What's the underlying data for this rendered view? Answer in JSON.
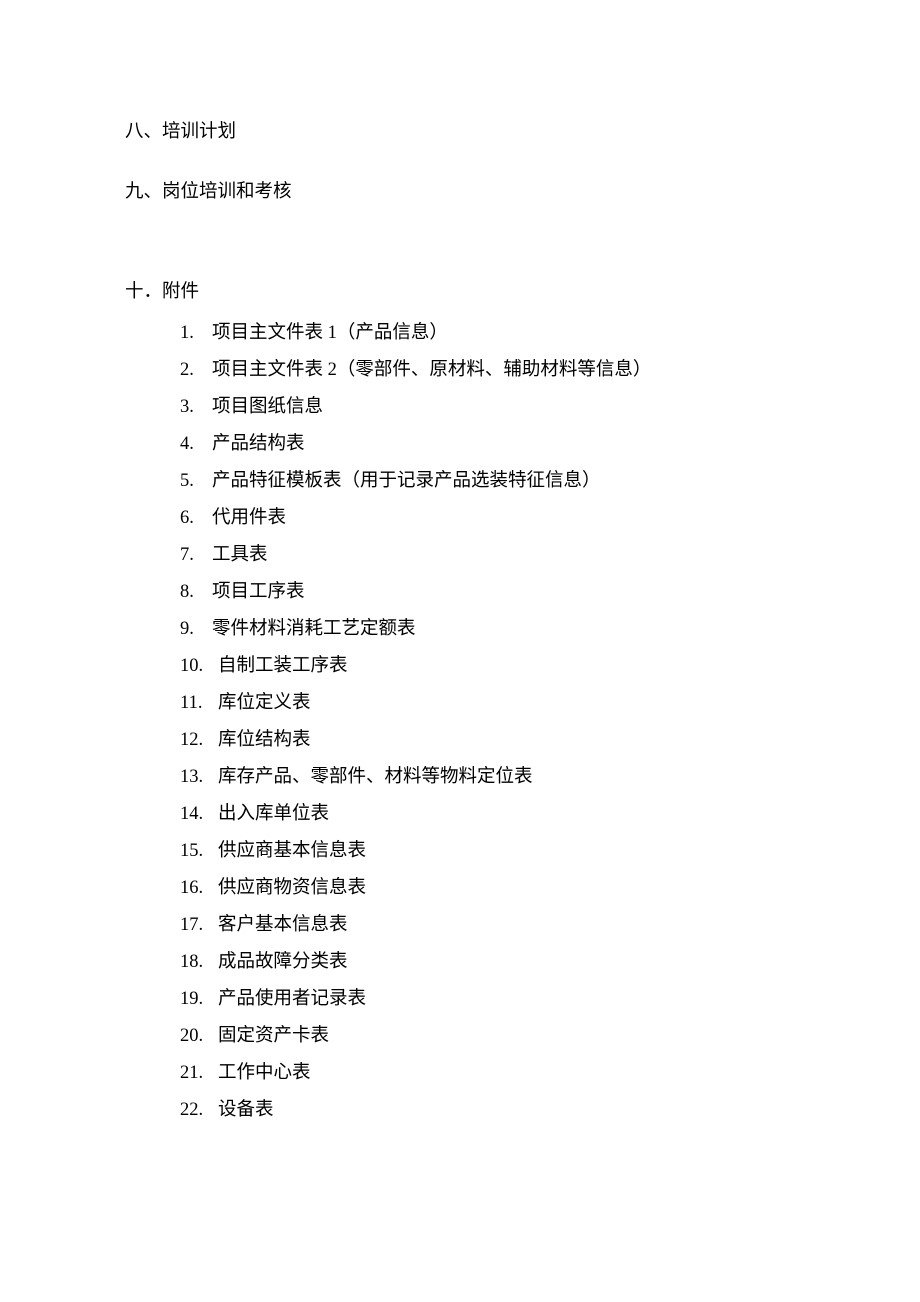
{
  "headings": {
    "h8": "八、培训计划",
    "h9": "九、岗位培训和考核",
    "h10": "十．附件"
  },
  "attachments": [
    {
      "num": "1.",
      "text": "项目主文件表 1（产品信息）"
    },
    {
      "num": "2.",
      "text": "项目主文件表 2（零部件、原材料、辅助材料等信息）"
    },
    {
      "num": "3.",
      "text": "项目图纸信息"
    },
    {
      "num": "4.",
      "text": "产品结构表"
    },
    {
      "num": "5.",
      "text": "产品特征模板表（用于记录产品选装特征信息）"
    },
    {
      "num": "6.",
      "text": "代用件表"
    },
    {
      "num": "7.",
      "text": "工具表"
    },
    {
      "num": "8.",
      "text": "项目工序表"
    },
    {
      "num": "9.",
      "text": "零件材料消耗工艺定额表"
    },
    {
      "num": "10.",
      "text": "自制工装工序表"
    },
    {
      "num": "11.",
      "text": "库位定义表"
    },
    {
      "num": "12.",
      "text": "库位结构表"
    },
    {
      "num": "13.",
      "text": "库存产品、零部件、材料等物料定位表"
    },
    {
      "num": "14.",
      "text": "出入库单位表"
    },
    {
      "num": "15.",
      "text": "供应商基本信息表"
    },
    {
      "num": "16.",
      "text": "供应商物资信息表"
    },
    {
      "num": "17.",
      "text": "客户基本信息表"
    },
    {
      "num": "18.",
      "text": "成品故障分类表"
    },
    {
      "num": "19.",
      "text": "产品使用者记录表"
    },
    {
      "num": "20.",
      "text": "固定资产卡表"
    },
    {
      "num": "21.",
      "text": "工作中心表"
    },
    {
      "num": "22.",
      "text": "设备表"
    }
  ]
}
